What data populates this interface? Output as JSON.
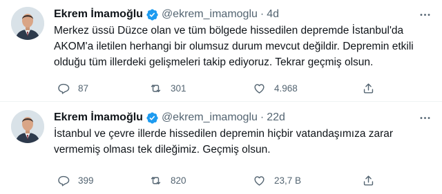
{
  "tweets": [
    {
      "author_name": "Ekrem İmamoğlu",
      "handle": "@ekrem_imamoglu",
      "separator": "·",
      "time": "4d",
      "text": "Merkez üssü Düzce olan ve tüm bölgede hissedilen depremde İstanbul'da AKOM'a iletilen herhangi bir olumsuz durum mevcut değildir. Depremin etkili olduğu tüm illerdeki gelişmeleri takip ediyoruz. Tekrar geçmiş olsun.",
      "replies": "87",
      "retweets": "301",
      "likes": "4.968"
    },
    {
      "author_name": "Ekrem İmamoğlu",
      "handle": "@ekrem_imamoglu",
      "separator": "·",
      "time": "22d",
      "text": "İstanbul ve çevre illerde hissedilen depremin hiçbir vatandaşımıza zarar vermemiş olması tek dileğimiz. Geçmiş olsun.",
      "replies": "399",
      "retweets": "820",
      "likes": "23,7 B"
    }
  ],
  "icons": {
    "verified": "verified-badge-icon",
    "more": "more-options-icon",
    "reply": "reply-icon",
    "retweet": "retweet-icon",
    "like": "heart-icon",
    "share": "share-icon"
  },
  "colors": {
    "verified": "#1d9bf0",
    "text": "#0f1419",
    "secondary": "#536471",
    "divider": "#eff3f4"
  }
}
